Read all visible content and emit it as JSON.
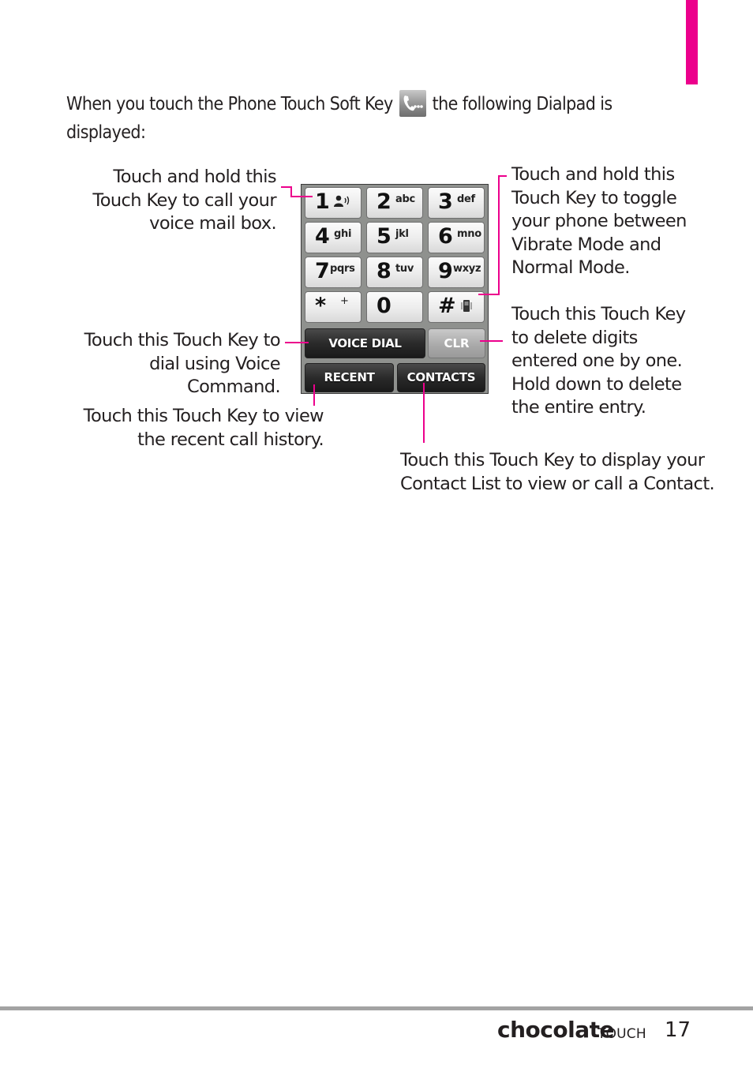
{
  "colors": {
    "accent": "#ec008c",
    "rule": "#a3a3a3"
  },
  "intro": {
    "before_icon": "When you touch the Phone Touch Soft Key",
    "icon": "phone-soft-key-icon",
    "after_icon": "the following Dialpad is displayed:"
  },
  "dialpad": {
    "keys": [
      {
        "num": "1",
        "letters": "",
        "icon": "voicemail-icon"
      },
      {
        "num": "2",
        "letters": "abc"
      },
      {
        "num": "3",
        "letters": "def"
      },
      {
        "num": "4",
        "letters": "ghi"
      },
      {
        "num": "5",
        "letters": "jkl"
      },
      {
        "num": "6",
        "letters": "mno"
      },
      {
        "num": "7",
        "letters": "pqrs"
      },
      {
        "num": "8",
        "letters": "tuv"
      },
      {
        "num": "9",
        "letters": "wxyz"
      },
      {
        "num": "*",
        "letters": "+"
      },
      {
        "num": "0",
        "letters": ""
      },
      {
        "num": "#",
        "letters": "",
        "icon": "vibrate-icon"
      }
    ],
    "voice_dial": "VOICE DIAL",
    "clr": "CLR",
    "recent": "RECENT",
    "contacts": "CONTACTS"
  },
  "callouts": {
    "voicemail": [
      "Touch and hold this",
      "Touch Key to call your",
      "voice mail box."
    ],
    "vibrate": [
      "Touch and hold this",
      "Touch Key to toggle",
      "your phone between",
      "Vibrate Mode and",
      "Normal Mode."
    ],
    "clr": [
      "Touch this Touch Key",
      "to delete digits",
      "entered one by one.",
      "Hold down to delete",
      "the entire entry."
    ],
    "voice_dial": [
      "Touch this Touch Key to",
      "dial using Voice",
      "Command."
    ],
    "recent": [
      "Touch this Touch Key to view",
      "the recent call history."
    ],
    "contacts": [
      "Touch this Touch Key to display your",
      "Contact List to view or call a Contact."
    ]
  },
  "footer": {
    "brand": "chocolate",
    "brand_sub": "TOUCH",
    "page_number": "17"
  }
}
